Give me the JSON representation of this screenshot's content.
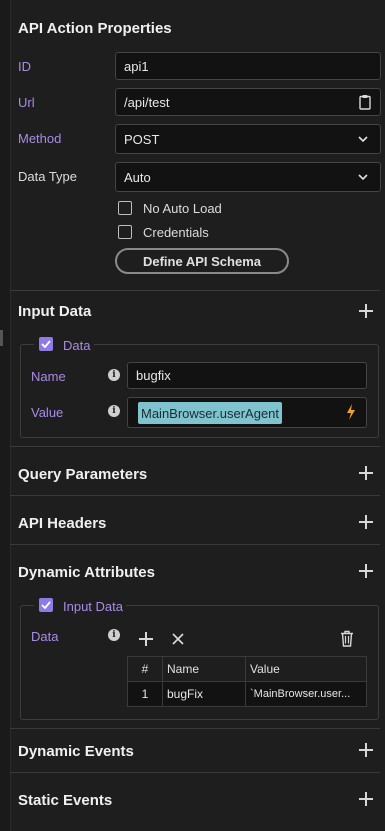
{
  "panel": {
    "title": "API Action Properties"
  },
  "fields": {
    "id": {
      "label": "ID",
      "value": "api1"
    },
    "url": {
      "label": "Url",
      "value": "/api/test"
    },
    "method": {
      "label": "Method",
      "value": "POST"
    },
    "data_type": {
      "label": "Data Type",
      "value": "Auto"
    }
  },
  "checkboxes": {
    "no_auto_load": {
      "label": "No Auto Load",
      "checked": false
    },
    "credentials": {
      "label": "Credentials",
      "checked": false
    }
  },
  "schema_button": "Define API Schema",
  "input_data": {
    "section_title": "Input Data",
    "group_label": "Data",
    "name": {
      "label": "Name",
      "value": "bugfix"
    },
    "value": {
      "label": "Value",
      "chip": "MainBrowser.userAgent"
    }
  },
  "sections": {
    "query_parameters": "Query Parameters",
    "api_headers": "API Headers",
    "dynamic_attributes": "Dynamic Attributes",
    "dynamic_events": "Dynamic Events",
    "static_events": "Static Events"
  },
  "dynamic_attributes": {
    "group_label": "Input Data",
    "data_label": "Data",
    "table": {
      "headers": [
        "#",
        "Name",
        "Value"
      ],
      "rows": [
        [
          "1",
          "bugFix",
          "`MainBrowser.user..."
        ]
      ]
    }
  },
  "colors": {
    "accent": "#8f7be8",
    "label_purple": "#a98be6",
    "chip": "#7fc3cf",
    "bolt": "#f0a030"
  },
  "icons": [
    "clipboard-icon",
    "chevron-down-icon",
    "plus-icon",
    "info-icon",
    "bolt-icon",
    "close-icon",
    "trash-icon",
    "check-icon"
  ]
}
